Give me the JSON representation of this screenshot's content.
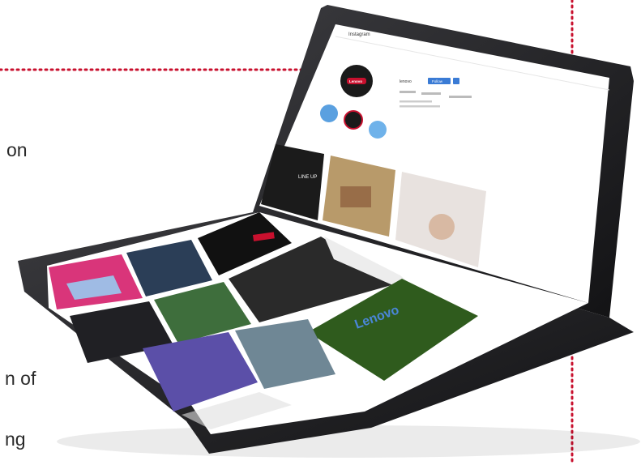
{
  "page_fragments": {
    "line1": "on",
    "line2": "n of",
    "line3": "ng"
  },
  "device": {
    "brand_logo": "Lenovo",
    "screen_app": "Instagram",
    "profile": {
      "name": "lenovo",
      "follow_label": "Follow"
    },
    "tiles": [
      {
        "name": "tile-text-poster",
        "color": "#1b1b1b"
      },
      {
        "name": "tile-painting",
        "color": "#b89a6a"
      },
      {
        "name": "tile-hand-glass",
        "color": "#e8e2df"
      },
      {
        "name": "tile-dark-logo",
        "color": "#111111"
      },
      {
        "name": "tile-pink-device",
        "color": "#d9357a"
      },
      {
        "name": "tile-aerial-city",
        "color": "#2b3e57"
      },
      {
        "name": "tile-blue-green",
        "color": "#3e6e3c"
      },
      {
        "name": "tile-people",
        "color": "#2a2a2a"
      },
      {
        "name": "tile-lenovo-field",
        "color": "#2f5b1d"
      },
      {
        "name": "tile-dark-room",
        "color": "#202024"
      },
      {
        "name": "tile-purple-art",
        "color": "#5b4fa8"
      },
      {
        "name": "tile-city-view",
        "color": "#6f8795"
      }
    ],
    "colors": {
      "bezel": "#1e1e21",
      "screen_bg": "#ffffff",
      "accent_red": "#c8102e",
      "dot_red": "#c8102e"
    }
  }
}
